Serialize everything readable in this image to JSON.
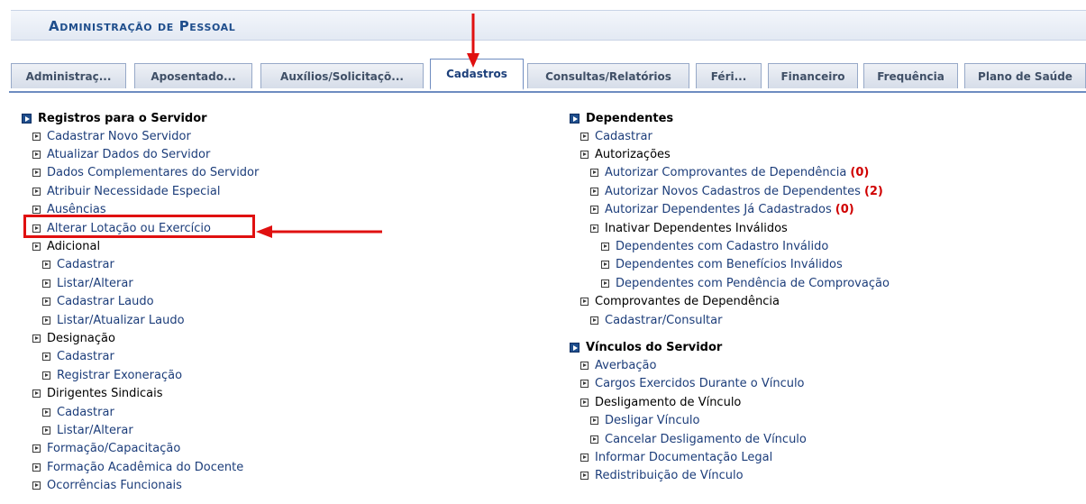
{
  "header": {
    "title": "Administração de Pessoal"
  },
  "tabs": [
    {
      "label": "Administraç...",
      "active": false
    },
    {
      "label": "Aposentado...",
      "active": false
    },
    {
      "label": "Auxílios/Solicitaçõ...",
      "active": false
    },
    {
      "label": "Cadastros",
      "active": true
    },
    {
      "label": "Consultas/Relatórios",
      "active": false
    },
    {
      "label": "Féri...",
      "active": false
    },
    {
      "label": "Financeiro",
      "active": false
    },
    {
      "label": "Frequência",
      "active": false
    },
    {
      "label": "Plano de Saúde",
      "active": false
    }
  ],
  "left": {
    "title": "Registros para o Servidor",
    "items": [
      {
        "label": "Cadastrar Novo Servidor",
        "level": 1,
        "link": true
      },
      {
        "label": "Atualizar Dados do Servidor",
        "level": 1,
        "link": true
      },
      {
        "label": "Dados Complementares do Servidor",
        "level": 1,
        "link": true
      },
      {
        "label": "Atribuir Necessidade Especial",
        "level": 1,
        "link": true
      },
      {
        "label": "Ausências",
        "level": 1,
        "link": true
      },
      {
        "label": "Alterar Lotação ou Exercício",
        "level": 1,
        "link": true,
        "highlighted": true
      },
      {
        "label": "Adicional",
        "level": 1,
        "link": false
      },
      {
        "label": "Cadastrar",
        "level": 2,
        "link": true
      },
      {
        "label": "Listar/Alterar",
        "level": 2,
        "link": true
      },
      {
        "label": "Cadastrar Laudo",
        "level": 2,
        "link": true
      },
      {
        "label": "Listar/Atualizar Laudo",
        "level": 2,
        "link": true
      },
      {
        "label": "Designação",
        "level": 1,
        "link": false
      },
      {
        "label": "Cadastrar",
        "level": 2,
        "link": true
      },
      {
        "label": "Registrar Exoneração",
        "level": 2,
        "link": true
      },
      {
        "label": "Dirigentes Sindicais",
        "level": 1,
        "link": false
      },
      {
        "label": "Cadastrar",
        "level": 2,
        "link": true
      },
      {
        "label": "Listar/Alterar",
        "level": 2,
        "link": true
      },
      {
        "label": "Formação/Capacitação",
        "level": 1,
        "link": true
      },
      {
        "label": "Formação Acadêmica do Docente",
        "level": 1,
        "link": true
      },
      {
        "label": "Ocorrências Funcionais",
        "level": 1,
        "link": true
      }
    ]
  },
  "right": {
    "sections": [
      {
        "title": "Dependentes",
        "items": [
          {
            "label": "Cadastrar",
            "level": 1,
            "link": true
          },
          {
            "label": "Autorizações",
            "level": 1,
            "link": false
          },
          {
            "label": "Autorizar Comprovantes de Dependência",
            "count": "(0)",
            "level": 2,
            "link": true
          },
          {
            "label": "Autorizar Novos Cadastros de Dependentes",
            "count": "(2)",
            "level": 2,
            "link": true
          },
          {
            "label": "Autorizar Dependentes Já Cadastrados",
            "count": "(0)",
            "level": 2,
            "link": true
          },
          {
            "label": "Inativar Dependentes Inválidos",
            "level": 2,
            "link": false
          },
          {
            "label": "Dependentes com Cadastro Inválido",
            "level": 3,
            "link": true
          },
          {
            "label": "Dependentes com Benefícios Inválidos",
            "level": 3,
            "link": true
          },
          {
            "label": "Dependentes com Pendência de Comprovação",
            "level": 3,
            "link": true
          },
          {
            "label": "Comprovantes de Dependência",
            "level": 1,
            "link": false
          },
          {
            "label": "Cadastrar/Consultar",
            "level": 2,
            "link": true
          }
        ]
      },
      {
        "title": "Vínculos do Servidor",
        "items": [
          {
            "label": "Averbação",
            "level": 1,
            "link": true
          },
          {
            "label": "Cargos Exercidos Durante o Vínculo",
            "level": 1,
            "link": true
          },
          {
            "label": "Desligamento de Vínculo",
            "level": 1,
            "link": false
          },
          {
            "label": "Desligar Vínculo",
            "level": 2,
            "link": true
          },
          {
            "label": "Cancelar Desligamento de Vínculo",
            "level": 2,
            "link": true
          },
          {
            "label": "Informar Documentação Legal",
            "level": 1,
            "link": true
          },
          {
            "label": "Redistribuição de Vínculo",
            "level": 1,
            "link": true
          }
        ]
      }
    ]
  },
  "colors": {
    "accent": "#1f4e8c",
    "link": "#1c3d7a",
    "annotation": "#e01010",
    "count": "#d00000"
  }
}
